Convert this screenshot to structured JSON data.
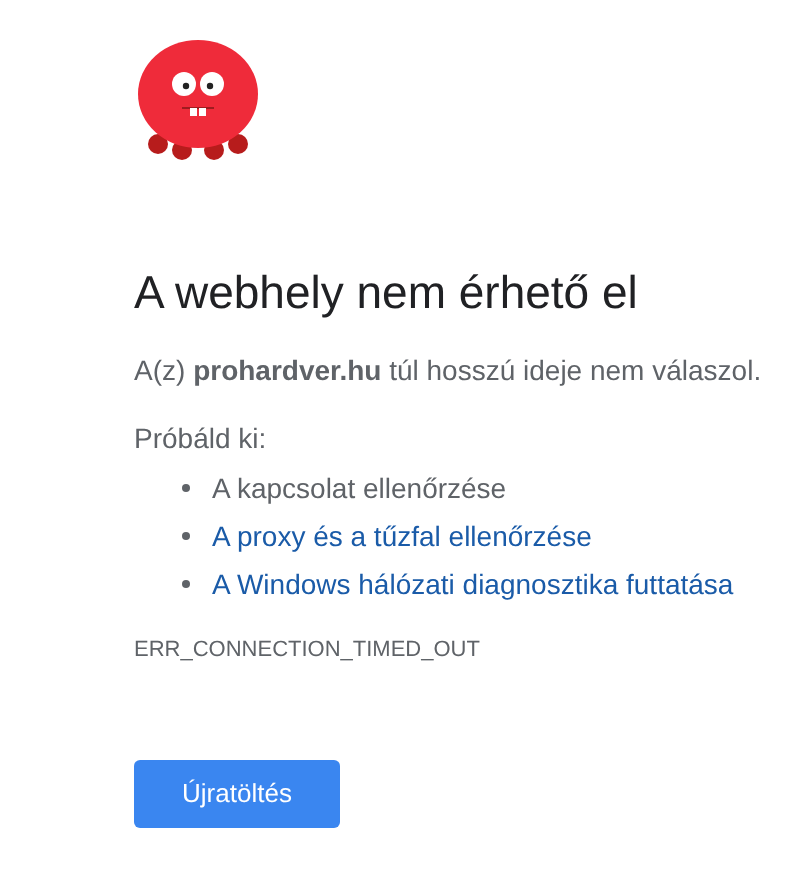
{
  "title": "A webhely nem érhető el",
  "message": "A(z) **prohardver.hu** túl hosszú ideje nem válaszol.",
  "suggestions_heading": "Próbáld ki:",
  "suggestions": [
    {
      "kind": "text",
      "label": "A kapcsolat ellenőrzése"
    },
    {
      "kind": "link",
      "label": "A proxy és a tűzfal ellenőrzése"
    },
    {
      "kind": "link",
      "label": "A Windows hálózati diagnosztika futtatása"
    }
  ],
  "error_code": "ERR_CONNECTION_TIMED_OUT",
  "reload_button": "Újratöltés"
}
